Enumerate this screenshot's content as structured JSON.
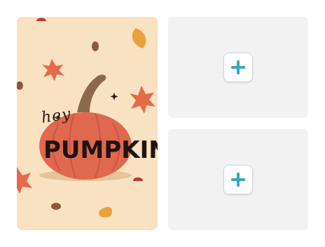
{
  "card": {
    "greeting": "hey",
    "headline": "PUMPKIN",
    "colors": {
      "background": "#f8e2c1",
      "pumpkin": "#e0684f",
      "stem": "#8a6a4a"
    }
  },
  "slots": [
    {
      "icon": "plus-icon",
      "accent": "#3aa8b8"
    },
    {
      "icon": "plus-icon",
      "accent": "#3aa8b8"
    }
  ]
}
